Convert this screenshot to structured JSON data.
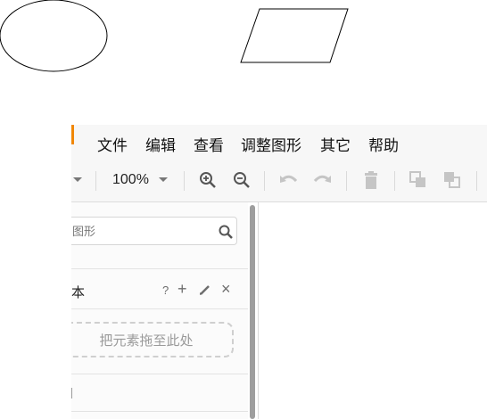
{
  "menu": {
    "items": [
      "文件",
      "编辑",
      "查看",
      "调整图形",
      "其它",
      "帮助"
    ]
  },
  "toolbar": {
    "zoom": "100%",
    "icons": [
      "zoom-in-icon",
      "zoom-out-icon",
      "undo-icon",
      "redo-icon",
      "delete-icon",
      "to-front-icon",
      "to-back-icon"
    ]
  },
  "sidebar": {
    "search_placeholder": "图形",
    "scratchpad_title": "本",
    "scratchpad_actions": {
      "help": "?",
      "add": "+",
      "close": "×"
    },
    "drop_zone": "把元素拖至此处"
  },
  "colors": {
    "accent": "#f08705",
    "menubar_bg": "#f7f7f7",
    "icon": "#6d6d6d"
  }
}
